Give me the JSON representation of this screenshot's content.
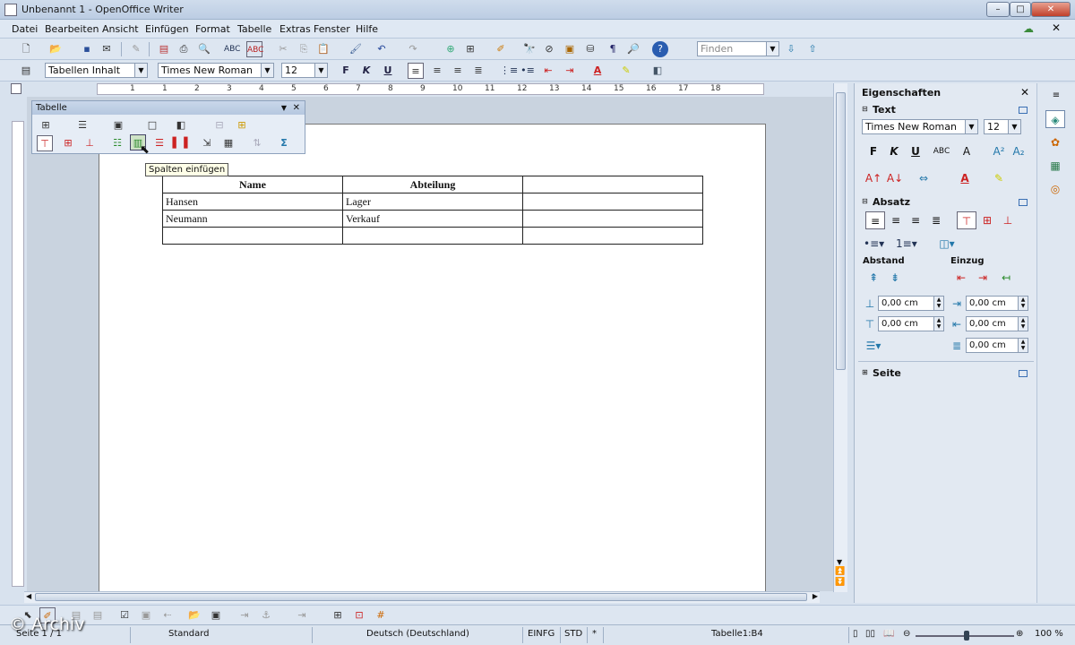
{
  "window": {
    "title": "Unbenannt 1 - OpenOffice Writer",
    "minimize": "–",
    "maximize": "□",
    "close": "✕"
  },
  "menu": [
    "Datei",
    "Bearbeiten",
    "Ansicht",
    "Einfügen",
    "Format",
    "Tabelle",
    "Extras",
    "Fenster",
    "Hilfe"
  ],
  "standard_toolbar": {
    "find_placeholder": "Finden"
  },
  "formatting_toolbar": {
    "style": "Tabellen Inhalt",
    "font": "Times New Roman",
    "size": "12",
    "bold": "F",
    "italic": "K",
    "underline": "U"
  },
  "ruler_labels": [
    "1",
    "1",
    "2",
    "3",
    "4",
    "5",
    "6",
    "7",
    "8",
    "9",
    "10",
    "11",
    "12",
    "13",
    "14",
    "15",
    "16",
    "17",
    "18"
  ],
  "table_toolbar": {
    "title": "Tabelle",
    "tooltip": "Spalten einfügen"
  },
  "document_table": {
    "headers": [
      "Name",
      "Abteilung",
      ""
    ],
    "rows": [
      [
        "Hansen",
        "Lager",
        ""
      ],
      [
        "Neumann",
        "Verkauf",
        ""
      ],
      [
        "",
        "",
        ""
      ]
    ]
  },
  "sidebar": {
    "title": "Eigenschaften",
    "text_section": "Text",
    "font": "Times New Roman",
    "size": "12",
    "bold": "F",
    "italic": "K",
    "underline": "U",
    "paragraph_section": "Absatz",
    "spacing_label": "Abstand",
    "indent_label": "Einzug",
    "values": [
      "0,00 cm",
      "0,00 cm",
      "0,00 cm",
      "0,00 cm",
      "0,00 cm"
    ],
    "page_section": "Seite"
  },
  "statusbar": {
    "page": "Seite 1 / 1",
    "style": "Standard",
    "language": "Deutsch (Deutschland)",
    "insert_mode": "EINFG",
    "selection_mode": "STD",
    "modified": "*",
    "cell": "Tabelle1:B4",
    "zoom": "100 %"
  },
  "watermark": "© Archiv"
}
